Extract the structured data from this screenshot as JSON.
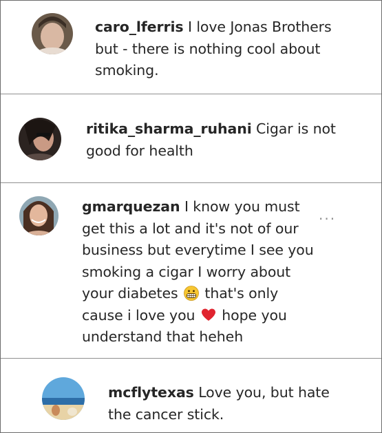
{
  "comments": [
    {
      "username": "caro_lferris",
      "text_lines": [
        "I love Jonas Brothers",
        "but - there is nothing cool about",
        "smoking."
      ]
    },
    {
      "username": "ritika_sharma_ruhani",
      "text_lines": [
        "Cigar is not",
        "good for health"
      ]
    },
    {
      "username": "gmarquezan",
      "text_lines": [
        "I know you must",
        "get this a lot and it's not of our",
        "business but everytime I see you",
        "smoking a cigar I worry about"
      ],
      "line5_before_emoji": "your diabetes",
      "line5_after_emoji": "that's only",
      "line6_before_emoji": "cause i love you",
      "line6_after_emoji": "hope you",
      "line7": "understand that heheh",
      "more_label": "..."
    },
    {
      "username": "mcflytexas",
      "text_lines": [
        "Love you, but hate",
        "the cancer stick."
      ]
    }
  ],
  "icons": {
    "grimace": "grimacing-face-emoji",
    "heart": "red-heart-emoji",
    "more": "more-options-icon"
  }
}
